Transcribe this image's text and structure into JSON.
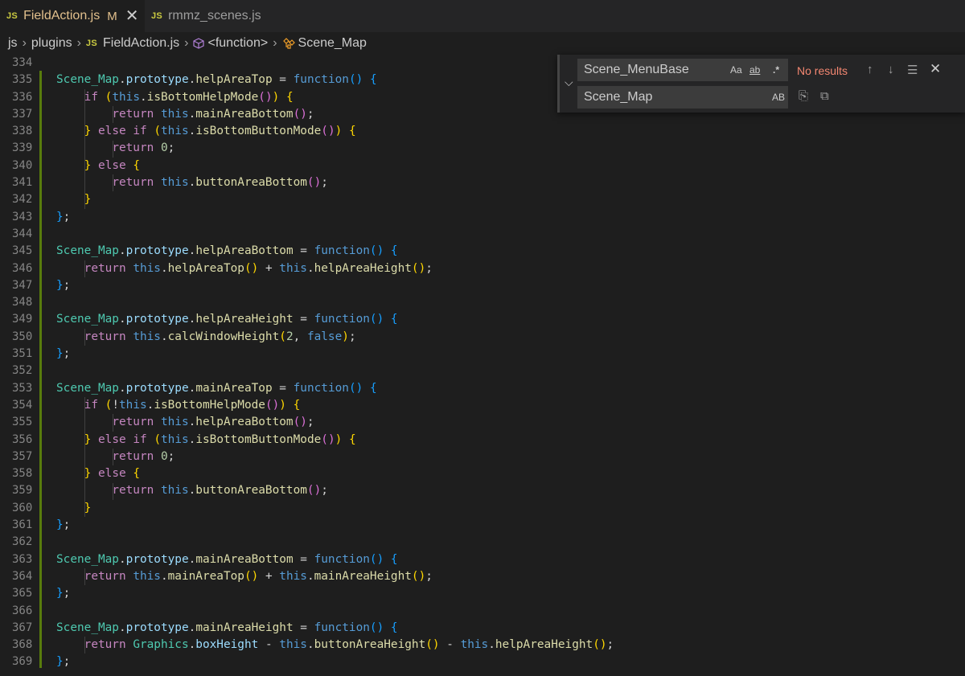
{
  "tabs": [
    {
      "badge": "JS",
      "name": "FieldAction.js",
      "modified": "M",
      "close": "✕"
    },
    {
      "badge": "JS",
      "name": "rmmz_scenes.js"
    }
  ],
  "breadcrumb": {
    "folder1": "js",
    "folder2": "plugins",
    "file_badge": "JS",
    "file": "FieldAction.js",
    "symbol1": "<function>",
    "symbol2": "Scene_Map"
  },
  "find_widget": {
    "find_value": "Scene_MenuBase",
    "replace_value": "Scene_Map",
    "match_case": "Aa",
    "whole_word": "ab",
    "regex": ".*",
    "preserve_case": "AB",
    "result_text": "No results"
  },
  "line_numbers": [
    "334",
    "335",
    "336",
    "337",
    "338",
    "339",
    "340",
    "341",
    "342",
    "343",
    "344",
    "345",
    "346",
    "347",
    "348",
    "349",
    "350",
    "351",
    "352",
    "353",
    "354",
    "355",
    "356",
    "357",
    "358",
    "359",
    "360",
    "361",
    "362",
    "363",
    "364",
    "365",
    "366",
    "367",
    "368",
    "369"
  ],
  "code_lines": [
    [],
    [
      [
        "Scene_Map",
        "cls"
      ],
      [
        ".",
        "op"
      ],
      [
        "prototype",
        "id"
      ],
      [
        ".",
        "op"
      ],
      [
        "helpAreaTop",
        "fn"
      ],
      [
        " = ",
        "op"
      ],
      [
        "function",
        "kw"
      ],
      [
        "()",
        "b3"
      ],
      [
        " ",
        "op"
      ],
      [
        "{",
        "b3"
      ]
    ],
    [
      [
        "    ",
        "op"
      ],
      [
        "if",
        "ctl"
      ],
      [
        " ",
        "op"
      ],
      [
        "(",
        "b1"
      ],
      [
        "this",
        "kw"
      ],
      [
        ".",
        "op"
      ],
      [
        "isBottomHelpMode",
        "fn"
      ],
      [
        "()",
        "b2"
      ],
      [
        ")",
        "b1"
      ],
      [
        " ",
        "op"
      ],
      [
        "{",
        "b1"
      ]
    ],
    [
      [
        "        ",
        "op"
      ],
      [
        "return",
        "ctl"
      ],
      [
        " ",
        "op"
      ],
      [
        "this",
        "kw"
      ],
      [
        ".",
        "op"
      ],
      [
        "mainAreaBottom",
        "fn"
      ],
      [
        "()",
        "b2"
      ],
      [
        ";",
        "op"
      ]
    ],
    [
      [
        "    ",
        "op"
      ],
      [
        "}",
        "b1"
      ],
      [
        " ",
        "op"
      ],
      [
        "else",
        "ctl"
      ],
      [
        " ",
        "op"
      ],
      [
        "if",
        "ctl"
      ],
      [
        " ",
        "op"
      ],
      [
        "(",
        "b1"
      ],
      [
        "this",
        "kw"
      ],
      [
        ".",
        "op"
      ],
      [
        "isBottomButtonMode",
        "fn"
      ],
      [
        "()",
        "b2"
      ],
      [
        ")",
        "b1"
      ],
      [
        " ",
        "op"
      ],
      [
        "{",
        "b1"
      ]
    ],
    [
      [
        "        ",
        "op"
      ],
      [
        "return",
        "ctl"
      ],
      [
        " ",
        "op"
      ],
      [
        "0",
        "num"
      ],
      [
        ";",
        "op"
      ]
    ],
    [
      [
        "    ",
        "op"
      ],
      [
        "}",
        "b1"
      ],
      [
        " ",
        "op"
      ],
      [
        "else",
        "ctl"
      ],
      [
        " ",
        "op"
      ],
      [
        "{",
        "b1"
      ]
    ],
    [
      [
        "        ",
        "op"
      ],
      [
        "return",
        "ctl"
      ],
      [
        " ",
        "op"
      ],
      [
        "this",
        "kw"
      ],
      [
        ".",
        "op"
      ],
      [
        "buttonAreaBottom",
        "fn"
      ],
      [
        "()",
        "b2"
      ],
      [
        ";",
        "op"
      ]
    ],
    [
      [
        "    ",
        "op"
      ],
      [
        "}",
        "b1"
      ]
    ],
    [
      [
        "}",
        "b3"
      ],
      [
        ";",
        "op"
      ]
    ],
    [],
    [
      [
        "Scene_Map",
        "cls"
      ],
      [
        ".",
        "op"
      ],
      [
        "prototype",
        "id"
      ],
      [
        ".",
        "op"
      ],
      [
        "helpAreaBottom",
        "fn"
      ],
      [
        " = ",
        "op"
      ],
      [
        "function",
        "kw"
      ],
      [
        "()",
        "b3"
      ],
      [
        " ",
        "op"
      ],
      [
        "{",
        "b3"
      ]
    ],
    [
      [
        "    ",
        "op"
      ],
      [
        "return",
        "ctl"
      ],
      [
        " ",
        "op"
      ],
      [
        "this",
        "kw"
      ],
      [
        ".",
        "op"
      ],
      [
        "helpAreaTop",
        "fn"
      ],
      [
        "()",
        "b1"
      ],
      [
        " + ",
        "op"
      ],
      [
        "this",
        "kw"
      ],
      [
        ".",
        "op"
      ],
      [
        "helpAreaHeight",
        "fn"
      ],
      [
        "()",
        "b1"
      ],
      [
        ";",
        "op"
      ]
    ],
    [
      [
        "}",
        "b3"
      ],
      [
        ";",
        "op"
      ]
    ],
    [],
    [
      [
        "Scene_Map",
        "cls"
      ],
      [
        ".",
        "op"
      ],
      [
        "prototype",
        "id"
      ],
      [
        ".",
        "op"
      ],
      [
        "helpAreaHeight",
        "fn"
      ],
      [
        " = ",
        "op"
      ],
      [
        "function",
        "kw"
      ],
      [
        "()",
        "b3"
      ],
      [
        " ",
        "op"
      ],
      [
        "{",
        "b3"
      ]
    ],
    [
      [
        "    ",
        "op"
      ],
      [
        "return",
        "ctl"
      ],
      [
        " ",
        "op"
      ],
      [
        "this",
        "kw"
      ],
      [
        ".",
        "op"
      ],
      [
        "calcWindowHeight",
        "fn"
      ],
      [
        "(",
        "b1"
      ],
      [
        "2",
        "num"
      ],
      [
        ", ",
        "op"
      ],
      [
        "false",
        "kw"
      ],
      [
        ")",
        "b1"
      ],
      [
        ";",
        "op"
      ]
    ],
    [
      [
        "}",
        "b3"
      ],
      [
        ";",
        "op"
      ]
    ],
    [],
    [
      [
        "Scene_Map",
        "cls"
      ],
      [
        ".",
        "op"
      ],
      [
        "prototype",
        "id"
      ],
      [
        ".",
        "op"
      ],
      [
        "mainAreaTop",
        "fn"
      ],
      [
        " = ",
        "op"
      ],
      [
        "function",
        "kw"
      ],
      [
        "()",
        "b3"
      ],
      [
        " ",
        "op"
      ],
      [
        "{",
        "b3"
      ]
    ],
    [
      [
        "    ",
        "op"
      ],
      [
        "if",
        "ctl"
      ],
      [
        " ",
        "op"
      ],
      [
        "(",
        "b1"
      ],
      [
        "!",
        "op"
      ],
      [
        "this",
        "kw"
      ],
      [
        ".",
        "op"
      ],
      [
        "isBottomHelpMode",
        "fn"
      ],
      [
        "()",
        "b2"
      ],
      [
        ")",
        "b1"
      ],
      [
        " ",
        "op"
      ],
      [
        "{",
        "b1"
      ]
    ],
    [
      [
        "        ",
        "op"
      ],
      [
        "return",
        "ctl"
      ],
      [
        " ",
        "op"
      ],
      [
        "this",
        "kw"
      ],
      [
        ".",
        "op"
      ],
      [
        "helpAreaBottom",
        "fn"
      ],
      [
        "()",
        "b2"
      ],
      [
        ";",
        "op"
      ]
    ],
    [
      [
        "    ",
        "op"
      ],
      [
        "}",
        "b1"
      ],
      [
        " ",
        "op"
      ],
      [
        "else",
        "ctl"
      ],
      [
        " ",
        "op"
      ],
      [
        "if",
        "ctl"
      ],
      [
        " ",
        "op"
      ],
      [
        "(",
        "b1"
      ],
      [
        "this",
        "kw"
      ],
      [
        ".",
        "op"
      ],
      [
        "isBottomButtonMode",
        "fn"
      ],
      [
        "()",
        "b2"
      ],
      [
        ")",
        "b1"
      ],
      [
        " ",
        "op"
      ],
      [
        "{",
        "b1"
      ]
    ],
    [
      [
        "        ",
        "op"
      ],
      [
        "return",
        "ctl"
      ],
      [
        " ",
        "op"
      ],
      [
        "0",
        "num"
      ],
      [
        ";",
        "op"
      ]
    ],
    [
      [
        "    ",
        "op"
      ],
      [
        "}",
        "b1"
      ],
      [
        " ",
        "op"
      ],
      [
        "else",
        "ctl"
      ],
      [
        " ",
        "op"
      ],
      [
        "{",
        "b1"
      ]
    ],
    [
      [
        "        ",
        "op"
      ],
      [
        "return",
        "ctl"
      ],
      [
        " ",
        "op"
      ],
      [
        "this",
        "kw"
      ],
      [
        ".",
        "op"
      ],
      [
        "buttonAreaBottom",
        "fn"
      ],
      [
        "()",
        "b2"
      ],
      [
        ";",
        "op"
      ]
    ],
    [
      [
        "    ",
        "op"
      ],
      [
        "}",
        "b1"
      ]
    ],
    [
      [
        "}",
        "b3"
      ],
      [
        ";",
        "op"
      ]
    ],
    [],
    [
      [
        "Scene_Map",
        "cls"
      ],
      [
        ".",
        "op"
      ],
      [
        "prototype",
        "id"
      ],
      [
        ".",
        "op"
      ],
      [
        "mainAreaBottom",
        "fn"
      ],
      [
        " = ",
        "op"
      ],
      [
        "function",
        "kw"
      ],
      [
        "()",
        "b3"
      ],
      [
        " ",
        "op"
      ],
      [
        "{",
        "b3"
      ]
    ],
    [
      [
        "    ",
        "op"
      ],
      [
        "return",
        "ctl"
      ],
      [
        " ",
        "op"
      ],
      [
        "this",
        "kw"
      ],
      [
        ".",
        "op"
      ],
      [
        "mainAreaTop",
        "fn"
      ],
      [
        "()",
        "b1"
      ],
      [
        " + ",
        "op"
      ],
      [
        "this",
        "kw"
      ],
      [
        ".",
        "op"
      ],
      [
        "mainAreaHeight",
        "fn"
      ],
      [
        "()",
        "b1"
      ],
      [
        ";",
        "op"
      ]
    ],
    [
      [
        "}",
        "b3"
      ],
      [
        ";",
        "op"
      ]
    ],
    [],
    [
      [
        "Scene_Map",
        "cls"
      ],
      [
        ".",
        "op"
      ],
      [
        "prototype",
        "id"
      ],
      [
        ".",
        "op"
      ],
      [
        "mainAreaHeight",
        "fn"
      ],
      [
        " = ",
        "op"
      ],
      [
        "function",
        "kw"
      ],
      [
        "()",
        "b3"
      ],
      [
        " ",
        "op"
      ],
      [
        "{",
        "b3"
      ]
    ],
    [
      [
        "    ",
        "op"
      ],
      [
        "return",
        "ctl"
      ],
      [
        " ",
        "op"
      ],
      [
        "Graphics",
        "cls"
      ],
      [
        ".",
        "op"
      ],
      [
        "boxHeight",
        "id"
      ],
      [
        " - ",
        "op"
      ],
      [
        "this",
        "kw"
      ],
      [
        ".",
        "op"
      ],
      [
        "buttonAreaHeight",
        "fn"
      ],
      [
        "()",
        "b1"
      ],
      [
        " - ",
        "op"
      ],
      [
        "this",
        "kw"
      ],
      [
        ".",
        "op"
      ],
      [
        "helpAreaHeight",
        "fn"
      ],
      [
        "()",
        "b1"
      ],
      [
        ";",
        "op"
      ]
    ],
    [
      [
        "}",
        "b3"
      ],
      [
        ";",
        "op"
      ]
    ]
  ]
}
